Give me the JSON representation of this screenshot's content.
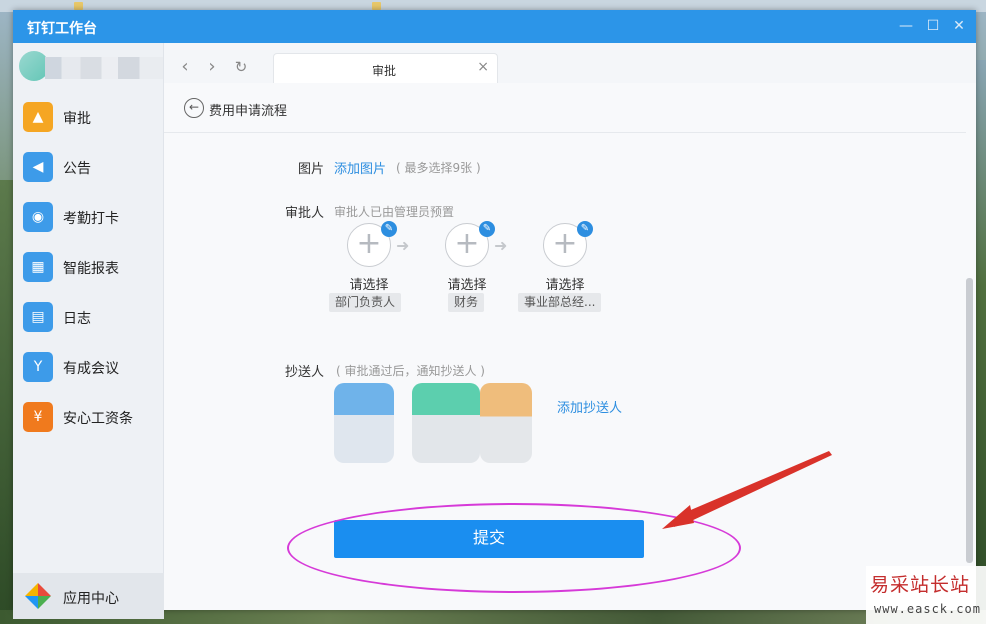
{
  "window": {
    "title": "钉钉工作台"
  },
  "sidebar": {
    "items": [
      {
        "label": "审批",
        "icon": "approval-icon",
        "color": "#f5a623"
      },
      {
        "label": "公告",
        "icon": "announcement-icon",
        "color": "#3d9be9"
      },
      {
        "label": "考勤打卡",
        "icon": "attendance-icon",
        "color": "#3d9be9"
      },
      {
        "label": "智能报表",
        "icon": "report-icon",
        "color": "#3d9be9"
      },
      {
        "label": "日志",
        "icon": "log-icon",
        "color": "#3d9be9"
      },
      {
        "label": "有成会议",
        "icon": "meeting-icon",
        "color": "#3d9be9"
      },
      {
        "label": "安心工资条",
        "icon": "payslip-icon",
        "color": "#f07a1d"
      }
    ],
    "app_center": "应用中心"
  },
  "tab": {
    "label": "审批"
  },
  "page": {
    "title": "费用申请流程"
  },
  "image_row": {
    "label": "图片",
    "link": "添加图片",
    "hint": "( 最多选择9张 )"
  },
  "approvers": {
    "label": "审批人",
    "hint": "审批人已由管理员预置",
    "list": [
      {
        "select": "请选择",
        "role": "部门负责人"
      },
      {
        "select": "请选择",
        "role": "财务"
      },
      {
        "select": "请选择",
        "role": "事业部总经..."
      }
    ]
  },
  "cc": {
    "label": "抄送人",
    "hint": "( 审批通过后，通知抄送人 )",
    "add": "添加抄送人"
  },
  "submit": {
    "label": "提交"
  },
  "accent": "#1a8ef0",
  "watermark": {
    "cn": "易采站长站",
    "en": "www.easck.com"
  }
}
